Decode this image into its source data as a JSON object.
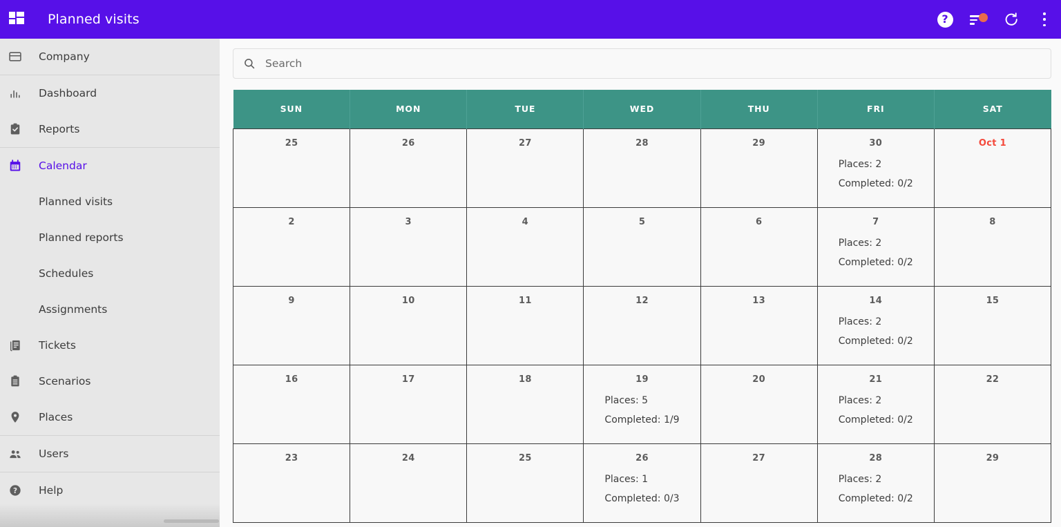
{
  "header": {
    "title": "Planned visits",
    "brand_icon": "grid-apps-icon",
    "actions": [
      {
        "name": "help-icon",
        "glyph": "?"
      },
      {
        "name": "filter-icon",
        "badge_color": "#ec6b4c"
      },
      {
        "name": "refresh-icon"
      },
      {
        "name": "more-vertical-icon"
      }
    ]
  },
  "sidebar": {
    "items": [
      {
        "label": "Company",
        "icon": "card-icon",
        "level": "top",
        "active": false,
        "divider_after": true
      },
      {
        "label": "Dashboard",
        "icon": "bar-chart-icon",
        "level": "top",
        "active": false,
        "divider_after": false
      },
      {
        "label": "Reports",
        "icon": "clipboard-check-icon",
        "level": "top",
        "active": false,
        "divider_after": true
      },
      {
        "label": "Calendar",
        "icon": "calendar-icon",
        "level": "top",
        "active": true,
        "divider_after": false
      },
      {
        "label": "Planned visits",
        "icon": "",
        "level": "sub",
        "active": false,
        "divider_after": false
      },
      {
        "label": "Planned reports",
        "icon": "",
        "level": "sub",
        "active": false,
        "divider_after": false
      },
      {
        "label": "Schedules",
        "icon": "",
        "level": "sub",
        "active": false,
        "divider_after": false
      },
      {
        "label": "Assignments",
        "icon": "",
        "level": "sub",
        "active": false,
        "divider_after": false
      },
      {
        "label": "Tickets",
        "icon": "document-icon",
        "level": "top",
        "active": false,
        "divider_after": false
      },
      {
        "label": "Scenarios",
        "icon": "clipboard-icon",
        "level": "top",
        "active": false,
        "divider_after": false
      },
      {
        "label": "Places",
        "icon": "map-pin-icon",
        "level": "top",
        "active": false,
        "divider_after": true
      },
      {
        "label": "Users",
        "icon": "people-icon",
        "level": "top",
        "active": false,
        "divider_after": true
      },
      {
        "label": "Help",
        "icon": "help-circle-icon",
        "level": "top",
        "active": false,
        "divider_after": false
      }
    ]
  },
  "search": {
    "value": "",
    "placeholder": "Search",
    "icon": "search-icon"
  },
  "calendar": {
    "weekday_headers": [
      "SUN",
      "MON",
      "TUE",
      "WED",
      "THU",
      "FRI",
      "SAT"
    ],
    "header_color": "#3d9486",
    "first_of_month_color": "#f4483a",
    "weeks": [
      [
        {
          "day": "25"
        },
        {
          "day": "26"
        },
        {
          "day": "27"
        },
        {
          "day": "28"
        },
        {
          "day": "29"
        },
        {
          "day": "30",
          "lines": [
            "Places: 2",
            "Completed: 0/2"
          ]
        },
        {
          "day": "Oct 1",
          "first_of_month": true
        }
      ],
      [
        {
          "day": "2"
        },
        {
          "day": "3"
        },
        {
          "day": "4"
        },
        {
          "day": "5"
        },
        {
          "day": "6"
        },
        {
          "day": "7",
          "lines": [
            "Places: 2",
            "Completed: 0/2"
          ]
        },
        {
          "day": "8"
        }
      ],
      [
        {
          "day": "9"
        },
        {
          "day": "10"
        },
        {
          "day": "11"
        },
        {
          "day": "12"
        },
        {
          "day": "13"
        },
        {
          "day": "14",
          "lines": [
            "Places: 2",
            "Completed: 0/2"
          ]
        },
        {
          "day": "15"
        }
      ],
      [
        {
          "day": "16"
        },
        {
          "day": "17"
        },
        {
          "day": "18"
        },
        {
          "day": "19",
          "lines": [
            "Places: 5",
            "Completed: 1/9"
          ]
        },
        {
          "day": "20"
        },
        {
          "day": "21",
          "lines": [
            "Places: 2",
            "Completed: 0/2"
          ]
        },
        {
          "day": "22"
        }
      ],
      [
        {
          "day": "23"
        },
        {
          "day": "24"
        },
        {
          "day": "25"
        },
        {
          "day": "26",
          "lines": [
            "Places: 1",
            "Completed: 0/3"
          ]
        },
        {
          "day": "27"
        },
        {
          "day": "28",
          "lines": [
            "Places: 2",
            "Completed: 0/2"
          ]
        },
        {
          "day": "29"
        }
      ]
    ]
  }
}
